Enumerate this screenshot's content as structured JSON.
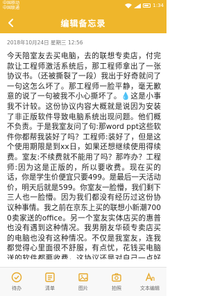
{
  "status": {
    "carrier_line1": "中国移动",
    "carrier_line2": "中国联通",
    "time": "1:34"
  },
  "appbar": {
    "title": "编辑备忘录"
  },
  "note": {
    "meta": "2018年10月24日 星期三 12:56",
    "body": "今天陪室友去买电脑，去的联想专卖店，付完款让工程师激活系统后，那工程师拿出了一张协议书。（还被撕裂了一段）我出于好奇就问了一句这怎么坏了。那工程师一脸平静，毫无歉意的说了一句被我不小心撕坏了。💧这是小事我不计较。这份协议内容大概就是说因为安装了非正版软件导致电脑系统出现问题。他们概不负责。于是我室友问了句:那word ppt这些软件你都帮我装好了吗？工程师:装好了，但是这个使用期限是到xx日，如果还想继续使用得续费。室友:不续费就不能用了吗？那咋办？工程师:因为这是正版的，所以要收费。现在买的话，你是学生价便宜只要499。是最后一天活动价，明天后就是599。你室友一脸懵，我们剩下三人也一脸懵。因为我们都没有经历过这份协议种事情。我之前在京东上买的联想小新潮7000卖家送的office。另一个室友实体店买的惠普也没有遇到这种情况。我男朋友华硕专卖店买的电脑也没有这种情况。不仅是我室友，连我都觉得心里面很不舒服，有点忧，花钱买电脑送的软件都要收费，这协议还是对自己一点好处都没有的，这个协议。可以说气很偏是，因为这个室友为人很腼腆，不知道怎么办，本身就不是有钱的人，买电脑的钱也是她自己一个暑假在外打工打暑假工赚来的，周围也没有过买电脑花几百块买软件的事情。所以一直在犹豫挣扎。"
  },
  "toolbar": {
    "items": [
      {
        "label": "待办",
        "icon": "todo-icon"
      },
      {
        "label": "清单",
        "icon": "list-icon"
      },
      {
        "label": "图片",
        "icon": "image-icon"
      },
      {
        "label": "拍照",
        "icon": "camera-icon"
      },
      {
        "label": "文本编辑",
        "icon": "text-format-icon"
      }
    ]
  },
  "colors": {
    "accent": "#efb62b",
    "icon": "#e6a82a"
  }
}
